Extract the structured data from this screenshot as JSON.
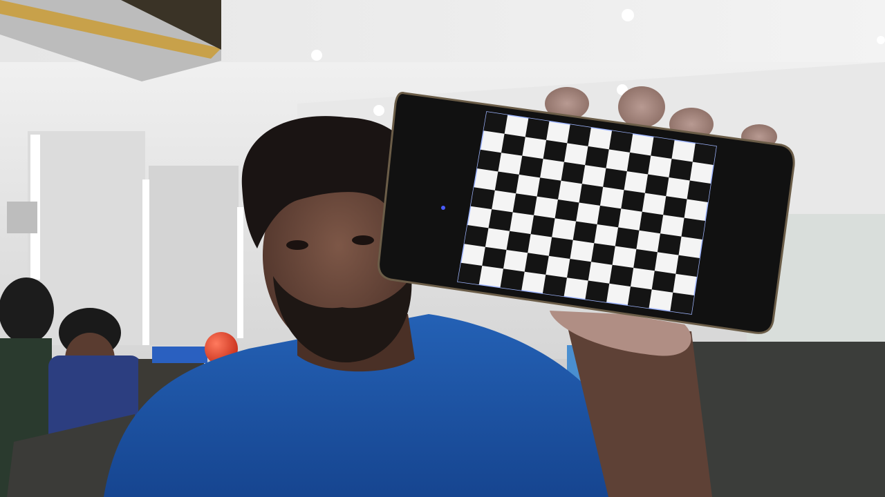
{
  "scene": {
    "description_free": true,
    "colors": {
      "wall": "#e3e3e3",
      "ceiling": "#ececec",
      "shirt": "#1d56a8",
      "skin": "#6b4a3c",
      "hair": "#1a1413",
      "phone_body": "#111111",
      "checker_dark": "#141414",
      "checker_light": "#f4f4f4",
      "balloon": "#e0442c",
      "chair": "#3b3d3a",
      "ac_unit": "#c8a14a"
    },
    "checkerboard": {
      "rows": 9,
      "cols": 11
    },
    "icons": [
      "ceiling-light-icon",
      "ac-unit-icon",
      "phone-dot-icon"
    ]
  }
}
